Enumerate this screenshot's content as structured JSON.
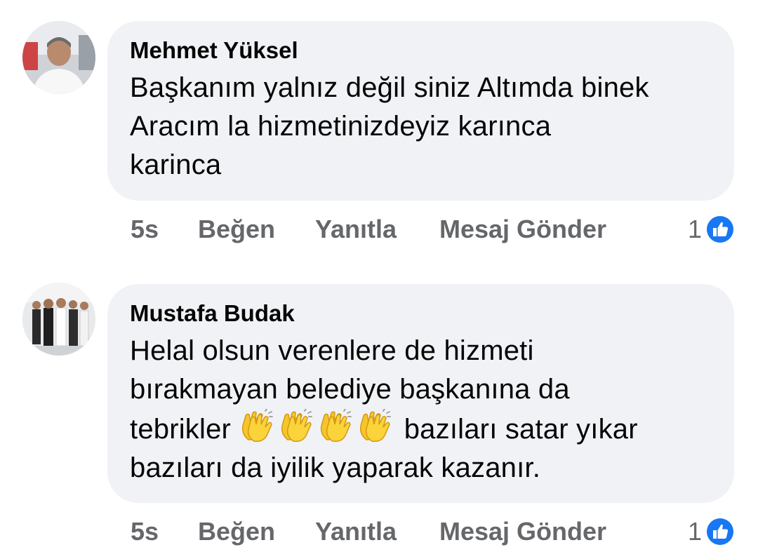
{
  "comments": [
    {
      "author": "Mehmet Yüksel",
      "text_lines": [
        "Başkanım yalnız değil siniz Altımda binek",
        "Aracım la hizmetinizdeyiz karınca",
        "karinca"
      ],
      "time": "5s",
      "like_label": "Beğen",
      "reply_label": "Yanıtla",
      "message_label": "Mesaj Gönder",
      "reaction_count": "1",
      "reaction_icon": "like-icon"
    },
    {
      "author": "Mustafa Budak",
      "text_lines": [
        "Helal olsun verenlere de hizmeti",
        "bırakmayan belediye başkanına da",
        "bazıları satar yıkar",
        "bazıları da iyilik yaparak kazanır."
      ],
      "text_line3_prefix": "tebrikler",
      "emoji": "clapping-hands-icon",
      "emoji_count": 4,
      "time": "5s",
      "like_label": "Beğen",
      "reply_label": "Yanıtla",
      "message_label": "Mesaj Gönder",
      "reaction_count": "1",
      "reaction_icon": "like-icon"
    }
  ],
  "colors": {
    "bubble": "#f0f2f5",
    "action_text": "#65676b",
    "like_blue": "#1877f2"
  }
}
